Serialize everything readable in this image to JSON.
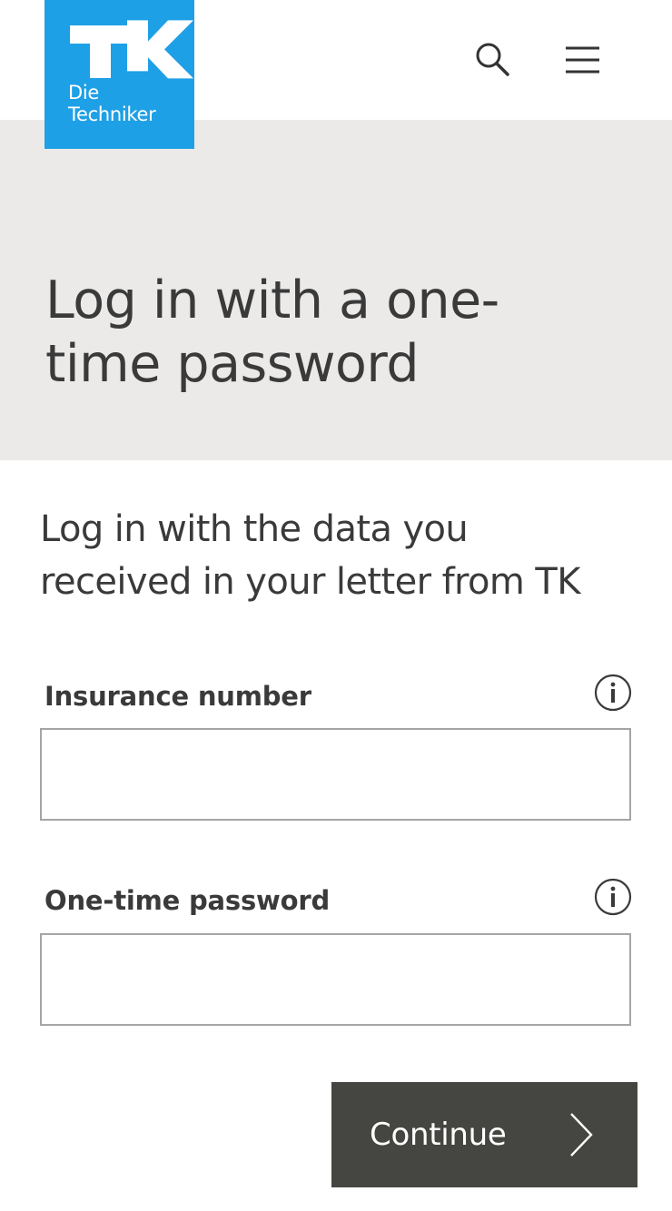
{
  "brand": {
    "logo_line1": "Die",
    "logo_line2": "Techniker",
    "logo_color": "#1ea0e6"
  },
  "header": {
    "search_icon": "search-icon",
    "menu_icon": "hamburger-menu-icon"
  },
  "hero": {
    "title_line1": "Log in with a one-",
    "title_line2": "time password",
    "background": "#ebeae9"
  },
  "intro": {
    "line1": "Log in with the data you",
    "line2": "received in your letter from TK"
  },
  "form": {
    "insurance_label": "Insurance number",
    "insurance_value": "",
    "otp_label": "One-time password",
    "otp_value": "",
    "info_icon": "info-icon"
  },
  "actions": {
    "continue_label": "Continue",
    "continue_icon": "chevron-right-icon",
    "button_color": "#454541"
  }
}
